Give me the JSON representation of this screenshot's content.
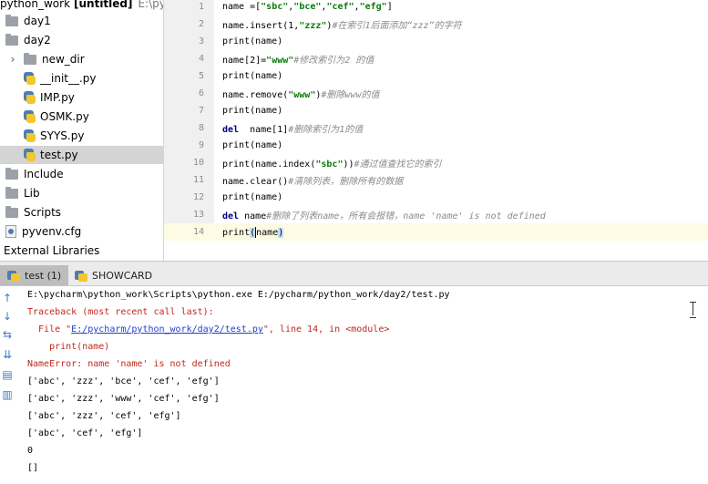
{
  "project": {
    "title": "python_work",
    "title_suffix": "[untitled]",
    "title_path": "E:\\pyc",
    "items": [
      {
        "label": "day1",
        "type": "folder",
        "indent": 0
      },
      {
        "label": "day2",
        "type": "folder",
        "indent": 0
      },
      {
        "label": "new_dir",
        "type": "folder",
        "indent": 1,
        "arrow": "›"
      },
      {
        "label": "__init__.py",
        "type": "py",
        "indent": 1
      },
      {
        "label": "IMP.py",
        "type": "py",
        "indent": 1
      },
      {
        "label": "OSMK.py",
        "type": "py",
        "indent": 1
      },
      {
        "label": "SYYS.py",
        "type": "py",
        "indent": 1
      },
      {
        "label": "test.py",
        "type": "py",
        "indent": 1,
        "selected": true
      },
      {
        "label": "Include",
        "type": "folder",
        "indent": 0
      },
      {
        "label": "Lib",
        "type": "folder",
        "indent": 0
      },
      {
        "label": "Scripts",
        "type": "folder",
        "indent": 0
      },
      {
        "label": "pyvenv.cfg",
        "type": "cfg",
        "indent": 0
      },
      {
        "label": "External Libraries",
        "type": "text",
        "indent": 0
      }
    ]
  },
  "editor": {
    "lines": [
      {
        "n": "1",
        "parts": [
          [
            "t",
            "name =["
          ],
          [
            "s",
            "\"sbc\""
          ],
          [
            "t",
            ","
          ],
          [
            "s",
            "\"bce\""
          ],
          [
            "t",
            ","
          ],
          [
            "s",
            "\"cef\""
          ],
          [
            "t",
            ","
          ],
          [
            "s",
            "\"efg\""
          ],
          [
            "t",
            "]"
          ]
        ]
      },
      {
        "n": "2",
        "parts": [
          [
            "t",
            "name.insert(1,"
          ],
          [
            "s",
            "\"zzz\""
          ],
          [
            "t",
            ")"
          ],
          [
            "c",
            "#在索引1后面添加“zzz”的字符"
          ]
        ]
      },
      {
        "n": "3",
        "parts": [
          [
            "t",
            "print(name)"
          ]
        ]
      },
      {
        "n": "4",
        "parts": [
          [
            "t",
            "name[2]="
          ],
          [
            "s",
            "\"www\""
          ],
          [
            "c",
            "#修改索引为2 的值"
          ]
        ]
      },
      {
        "n": "5",
        "parts": [
          [
            "t",
            "print(name)"
          ]
        ]
      },
      {
        "n": "6",
        "parts": [
          [
            "t",
            "name.remove("
          ],
          [
            "s",
            "\"www\""
          ],
          [
            "t",
            ")"
          ],
          [
            "c",
            "#删除www的值"
          ]
        ]
      },
      {
        "n": "7",
        "parts": [
          [
            "t",
            "print(name)"
          ]
        ]
      },
      {
        "n": "8",
        "parts": [
          [
            "k",
            "del"
          ],
          [
            "t",
            "  name[1]"
          ],
          [
            "c",
            "#删除索引为1的值"
          ]
        ]
      },
      {
        "n": "9",
        "parts": [
          [
            "t",
            "print(name)"
          ]
        ]
      },
      {
        "n": "10",
        "parts": [
          [
            "t",
            "print(name.index("
          ],
          [
            "s",
            "\"sbc\""
          ],
          [
            "t",
            "))"
          ],
          [
            "c",
            "#通过值查找它的索引"
          ]
        ]
      },
      {
        "n": "11",
        "parts": [
          [
            "t",
            "name.clear()"
          ],
          [
            "c",
            "#清除列表，删除所有的数据"
          ]
        ]
      },
      {
        "n": "12",
        "parts": [
          [
            "t",
            "print(name)"
          ]
        ]
      },
      {
        "n": "13",
        "parts": [
          [
            "k",
            "del"
          ],
          [
            "t",
            " name"
          ],
          [
            "c",
            "#删除了列表name，所有会报错，name 'name' is not defined"
          ]
        ]
      },
      {
        "n": "14",
        "current": true,
        "parts": [
          [
            "t",
            "print"
          ],
          [
            "b",
            "("
          ],
          [
            "t",
            "name"
          ],
          [
            "b",
            ")"
          ]
        ]
      }
    ]
  },
  "run": {
    "tabs": [
      {
        "label": "test (1)",
        "active": true
      },
      {
        "label": "SHOWCARD",
        "active": false
      }
    ],
    "side_icons": [
      "arrow-up-icon",
      "arrow-down-icon",
      "soft-wrap-icon",
      "scroll-to-end-icon",
      "print-icon",
      "trash-icon"
    ],
    "console": {
      "command": "E:\\pycharm\\python_work\\Scripts\\python.exe E:/pycharm/python_work/day2/test.py",
      "traceback_header": "Traceback (most recent call last):",
      "file_prefix": "  File \"",
      "file_link": "E:/pycharm/python_work/day2/test.py",
      "file_suffix": "\", line 14, in <module>",
      "source_line": "    print(name)",
      "error": "NameError: name 'name' is not defined",
      "outputs": [
        "['abc', 'zzz', 'bce', 'cef', 'efg']",
        "['abc', 'zzz', 'www', 'cef', 'efg']",
        "['abc', 'zzz', 'cef', 'efg']",
        "['abc', 'cef', 'efg']",
        "0",
        "[]"
      ]
    }
  },
  "colors": {
    "string": "#0a7a0a",
    "comment": "#8a8a8a",
    "keyword": "#000080",
    "error": "#c0281c",
    "link": "#1f3fd0",
    "current_line": "#fdfbe3",
    "selection": "#d4d4d4"
  }
}
